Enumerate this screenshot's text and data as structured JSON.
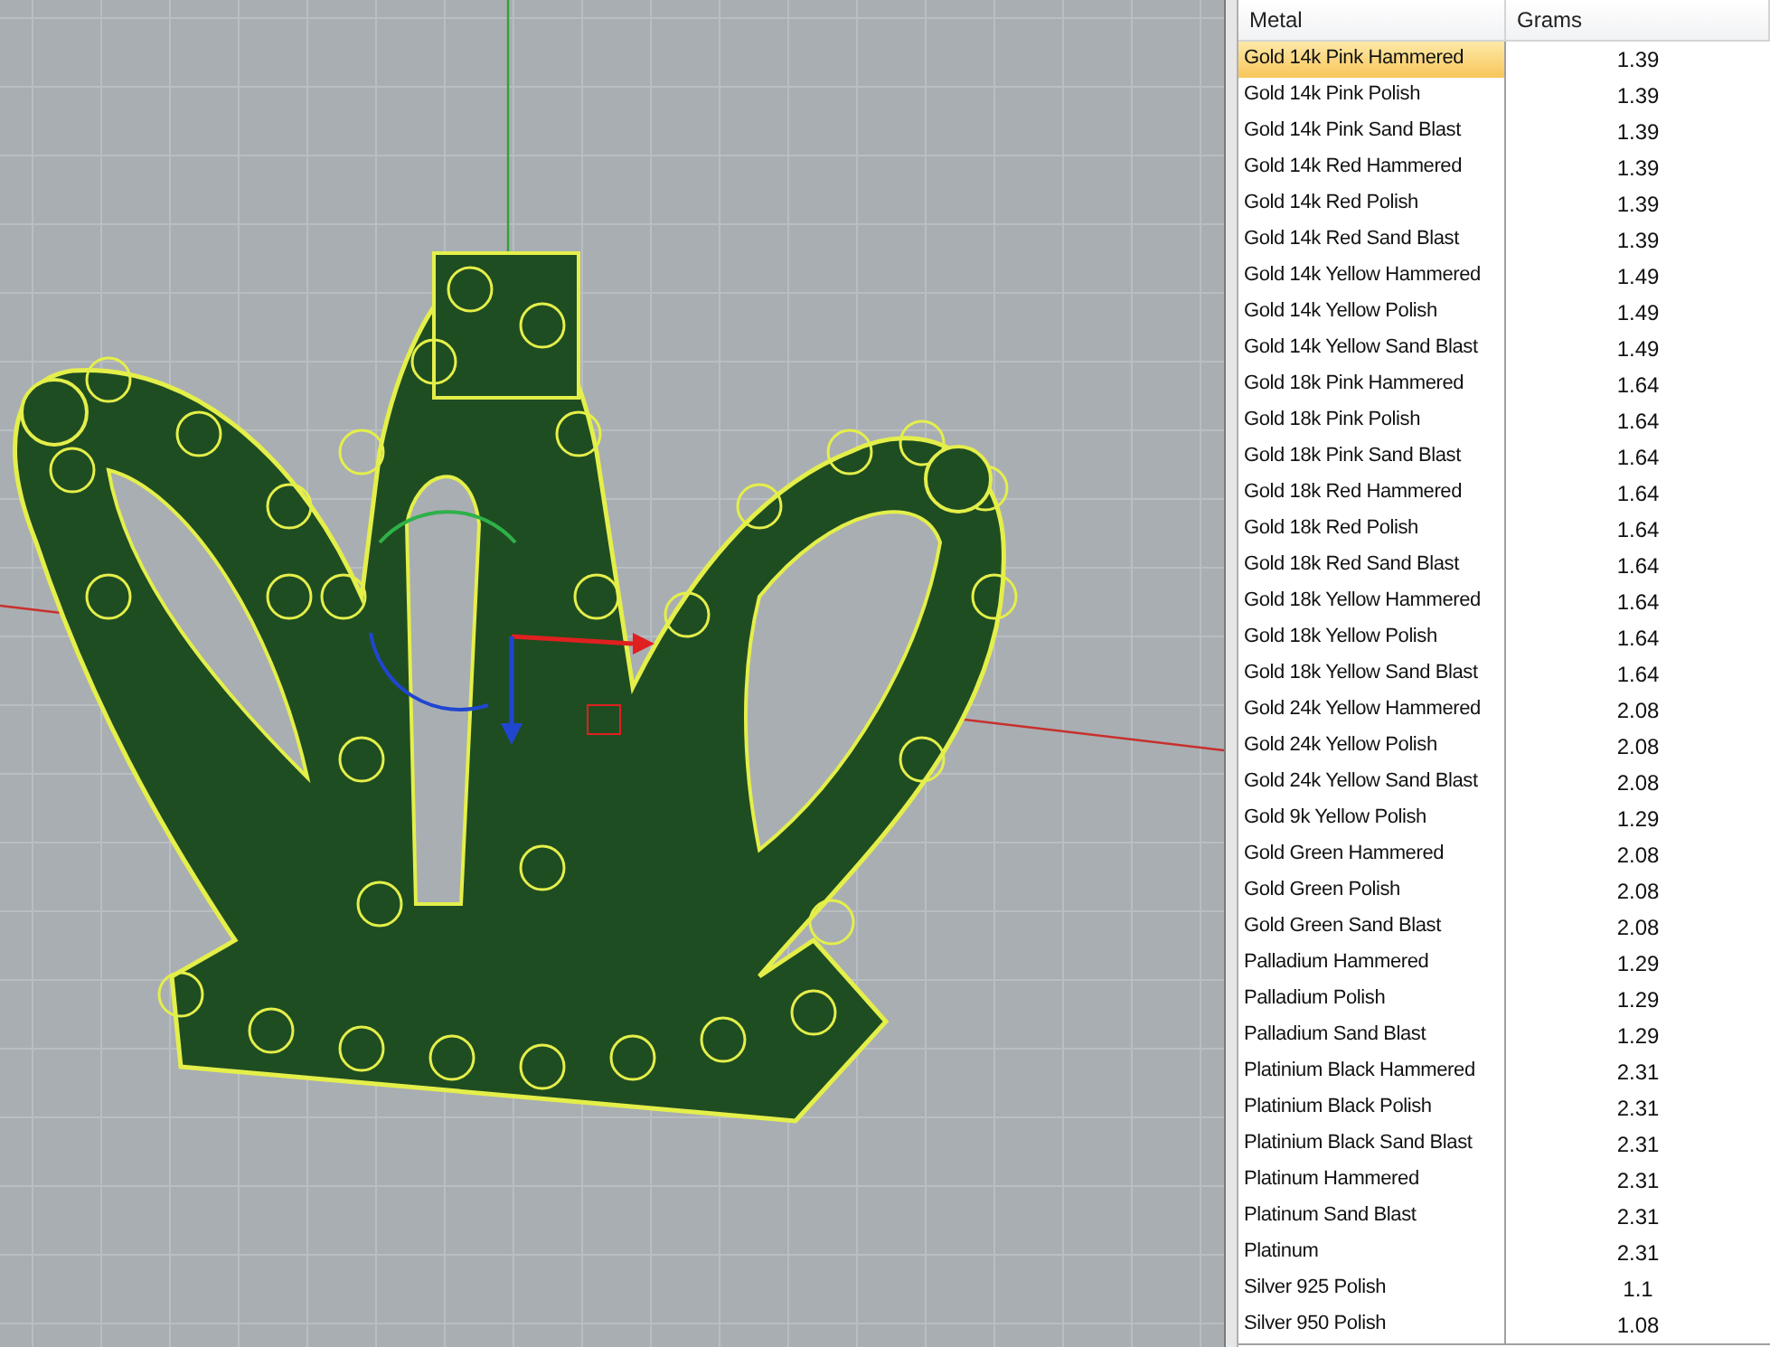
{
  "table": {
    "columns": [
      "Metal",
      "Grams"
    ],
    "rows": [
      {
        "metal": "Gold 14k Pink Hammered",
        "grams": "1.39",
        "selected": true
      },
      {
        "metal": "Gold 14k Pink Polish",
        "grams": "1.39",
        "selected": false
      },
      {
        "metal": "Gold 14k Pink Sand Blast",
        "grams": "1.39",
        "selected": false
      },
      {
        "metal": "Gold 14k Red Hammered",
        "grams": "1.39",
        "selected": false
      },
      {
        "metal": "Gold 14k Red Polish",
        "grams": "1.39",
        "selected": false
      },
      {
        "metal": "Gold 14k Red Sand Blast",
        "grams": "1.39",
        "selected": false
      },
      {
        "metal": "Gold 14k Yellow Hammered",
        "grams": "1.49",
        "selected": false
      },
      {
        "metal": "Gold 14k Yellow Polish",
        "grams": "1.49",
        "selected": false
      },
      {
        "metal": "Gold 14k Yellow Sand Blast",
        "grams": "1.49",
        "selected": false
      },
      {
        "metal": "Gold 18k Pink Hammered",
        "grams": "1.64",
        "selected": false
      },
      {
        "metal": "Gold 18k Pink Polish",
        "grams": "1.64",
        "selected": false
      },
      {
        "metal": "Gold 18k Pink Sand Blast",
        "grams": "1.64",
        "selected": false
      },
      {
        "metal": "Gold 18k Red Hammered",
        "grams": "1.64",
        "selected": false
      },
      {
        "metal": "Gold 18k Red Polish",
        "grams": "1.64",
        "selected": false
      },
      {
        "metal": "Gold 18k Red Sand Blast",
        "grams": "1.64",
        "selected": false
      },
      {
        "metal": "Gold 18k Yellow Hammered",
        "grams": "1.64",
        "selected": false
      },
      {
        "metal": "Gold 18k Yellow Polish",
        "grams": "1.64",
        "selected": false
      },
      {
        "metal": "Gold 18k Yellow Sand Blast",
        "grams": "1.64",
        "selected": false
      },
      {
        "metal": "Gold 24k Yellow Hammered",
        "grams": "2.08",
        "selected": false
      },
      {
        "metal": "Gold 24k Yellow Polish",
        "grams": "2.08",
        "selected": false
      },
      {
        "metal": "Gold 24k Yellow Sand Blast",
        "grams": "2.08",
        "selected": false
      },
      {
        "metal": "Gold 9k Yellow Polish",
        "grams": "1.29",
        "selected": false
      },
      {
        "metal": "Gold Green Hammered",
        "grams": "2.08",
        "selected": false
      },
      {
        "metal": "Gold Green Polish",
        "grams": "2.08",
        "selected": false
      },
      {
        "metal": "Gold Green Sand Blast",
        "grams": "2.08",
        "selected": false
      },
      {
        "metal": "Palladium Hammered",
        "grams": "1.29",
        "selected": false
      },
      {
        "metal": "Palladium Polish",
        "grams": "1.29",
        "selected": false
      },
      {
        "metal": "Palladium Sand Blast",
        "grams": "1.29",
        "selected": false
      },
      {
        "metal": "Platinium Black Hammered",
        "grams": "2.31",
        "selected": false
      },
      {
        "metal": "Platinium Black Polish",
        "grams": "2.31",
        "selected": false
      },
      {
        "metal": "Platinium Black Sand Blast",
        "grams": "2.31",
        "selected": false
      },
      {
        "metal": "Platinum Hammered",
        "grams": "2.31",
        "selected": false
      },
      {
        "metal": "Platinum Sand Blast",
        "grams": "2.31",
        "selected": false
      },
      {
        "metal": "Platinum",
        "grams": "2.31",
        "selected": false
      },
      {
        "metal": "Silver 925 Polish",
        "grams": "1.1",
        "selected": false
      },
      {
        "metal": "Silver 950 Polish",
        "grams": "1.08",
        "selected": false
      }
    ]
  }
}
